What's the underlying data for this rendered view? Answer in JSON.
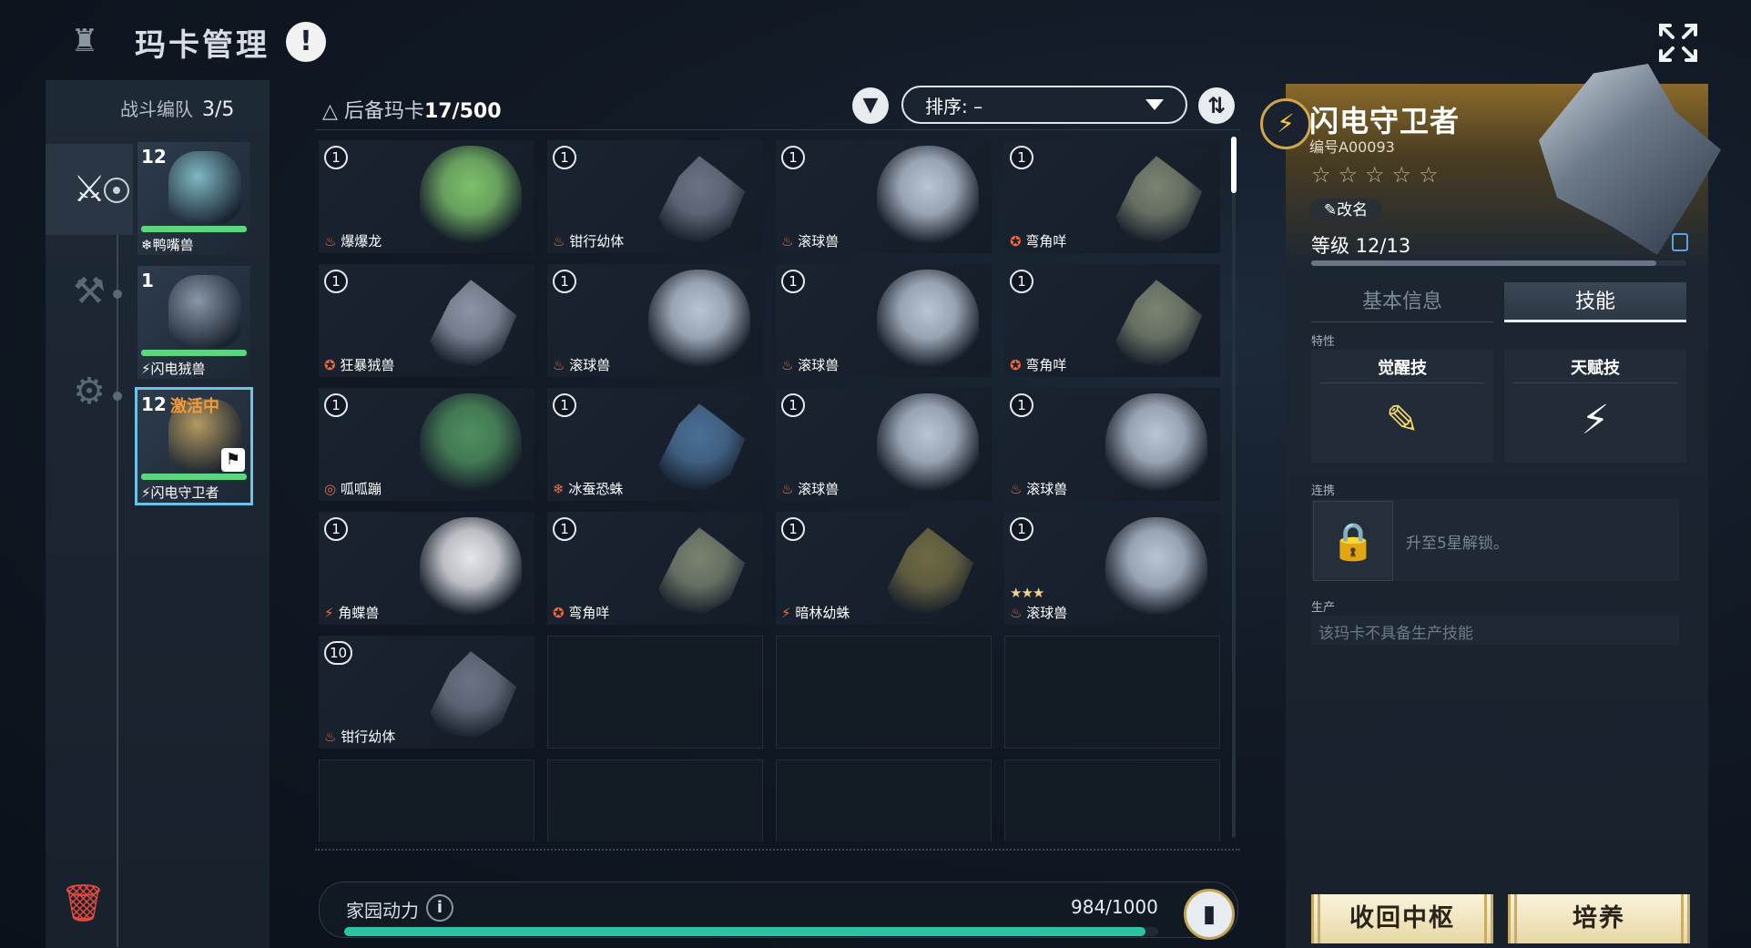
{
  "header": {
    "title": "玛卡管理",
    "alert_glyph": "!",
    "logo_glyph": "♜"
  },
  "team": {
    "label": "战斗编队",
    "count": "3/5",
    "roles": [
      "attack",
      "build",
      "craft"
    ],
    "members": [
      {
        "level": "12",
        "status": "",
        "name": "鸭嘴兽",
        "element": "ice",
        "element_glyph": "❄",
        "color": "#7fb8c4",
        "active": false
      },
      {
        "level": "1",
        "status": "",
        "name": "闪电狨兽",
        "element": "electric",
        "element_glyph": "⚡",
        "color": "#8a97a8",
        "active": false
      },
      {
        "level": "12",
        "status": "激活中",
        "name": "闪电守卫者",
        "element": "electric",
        "element_glyph": "⚡",
        "color": "#b39a61",
        "active": true
      }
    ]
  },
  "reserve": {
    "label": "后备玛卡",
    "count": "17/500",
    "sort_label": "排序: –"
  },
  "cards": [
    {
      "level": "1",
      "glyph": "♨",
      "name": "爆爆龙",
      "color": "#7cc06a",
      "shape": "blob",
      "stars": ""
    },
    {
      "level": "1",
      "glyph": "♨",
      "name": "钳行幼体",
      "color": "#6a7484",
      "shape": "spiky",
      "stars": ""
    },
    {
      "level": "1",
      "glyph": "♨",
      "name": "滚球兽",
      "color": "#b9c4d4",
      "shape": "blob",
      "stars": ""
    },
    {
      "level": "1",
      "glyph": "✪",
      "name": "弯角咩",
      "color": "#7a8270",
      "shape": "spiky",
      "stars": ""
    },
    {
      "level": "1",
      "glyph": "✪",
      "name": "狂暴狨兽",
      "color": "#8a94a4",
      "shape": "spiky",
      "stars": ""
    },
    {
      "level": "1",
      "glyph": "♨",
      "name": "滚球兽",
      "color": "#b9c4d4",
      "shape": "blob",
      "stars": ""
    },
    {
      "level": "1",
      "glyph": "♨",
      "name": "滚球兽",
      "color": "#b9c4d4",
      "shape": "blob",
      "stars": ""
    },
    {
      "level": "1",
      "glyph": "✪",
      "name": "弯角咩",
      "color": "#7a8270",
      "shape": "spiky",
      "stars": ""
    },
    {
      "level": "1",
      "glyph": "◎",
      "name": "呱呱蹦",
      "color": "#4e8f5e",
      "shape": "blob",
      "stars": ""
    },
    {
      "level": "1",
      "glyph": "❄",
      "name": "冰蚕恐蛛",
      "color": "#4a6f96",
      "shape": "spiky",
      "stars": ""
    },
    {
      "level": "1",
      "glyph": "♨",
      "name": "滚球兽",
      "color": "#b9c4d4",
      "shape": "blob",
      "stars": ""
    },
    {
      "level": "1",
      "glyph": "♨",
      "name": "滚球兽",
      "color": "#b9c4d4",
      "shape": "blob",
      "stars": ""
    },
    {
      "level": "1",
      "glyph": "⚡",
      "name": "角蝶兽",
      "color": "#e6e6ea",
      "shape": "blob",
      "stars": ""
    },
    {
      "level": "1",
      "glyph": "✪",
      "name": "弯角咩",
      "color": "#7a8270",
      "shape": "spiky",
      "stars": ""
    },
    {
      "level": "1",
      "glyph": "⚡",
      "name": "暗林幼蛛",
      "color": "#6f6a44",
      "shape": "spiky",
      "stars": ""
    },
    {
      "level": "1",
      "glyph": "♨",
      "name": "滚球兽",
      "color": "#b9c4d4",
      "shape": "blob",
      "stars": "★★★"
    },
    {
      "level": "10",
      "glyph": "♨",
      "name": "钳行幼体",
      "color": "#6a7484",
      "shape": "spiky",
      "stars": ""
    }
  ],
  "empty_slots": 7,
  "home_power": {
    "label": "家园动力",
    "value": "984/1000",
    "fraction": 0.984
  },
  "detail": {
    "element_glyph": "⚡",
    "name": "闪电守卫者",
    "id": "编号A00093",
    "stars": "☆☆☆☆☆",
    "rename": "✎改名",
    "level": "等级 12/13",
    "level_fraction": 0.92,
    "tabs": [
      "基本信息",
      "技能"
    ],
    "trait_label": "特性",
    "skill1_title": "觉醒技",
    "skill1_glyph": "✎",
    "skill2_title": "天赋技",
    "skill2_glyph": "⚡",
    "link_label": "连携",
    "link_text": "升至5星解锁。",
    "prod_label": "生产",
    "prod_text": "该玛卡不具备生产技能",
    "recall_button": "收回中枢",
    "train_button": "培养"
  }
}
